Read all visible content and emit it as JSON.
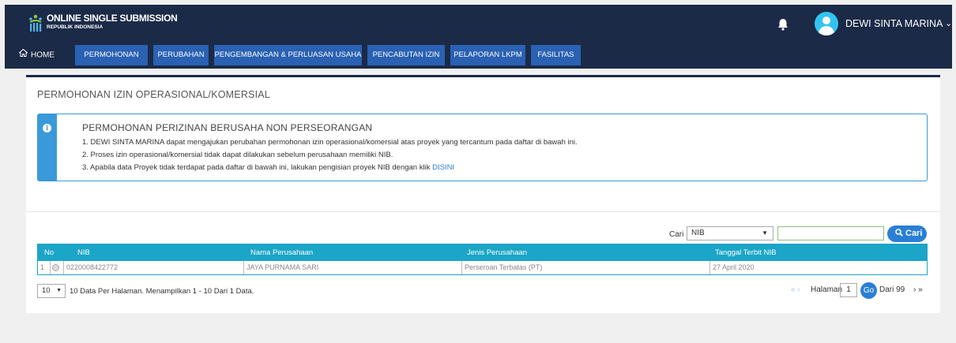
{
  "header": {
    "app_title": "ONLINE SINGLE SUBMISSION",
    "app_subtitle": "REPUBLIK INDONESIA",
    "username": "DEWI SINTA MARINA",
    "bell_icon": "bell-icon",
    "avatar_icon": "user-avatar-icon"
  },
  "nav": {
    "home": "HOME",
    "items": [
      "PERMOHONAN",
      "PERUBAHAN",
      "PENGEMBANGAN & PERLUASAN USAHA",
      "PENCABUTAN IZIN",
      "PELAPORAN LKPM",
      "FASILITAS"
    ]
  },
  "page": {
    "title": "PERMOHONAN IZIN OPERASIONAL/KOMERSIAL"
  },
  "info": {
    "title": "PERMOHONAN PERIZINAN BERUSAHA NON PERSEORANGAN",
    "line1": "1. DEWI SINTA MARINA dapat mengajukan perubahan permohonan izin operasional/komersial atas proyek yang tercantum pada daftar di bawah ini.",
    "line2": "2. Proses izin operasional/komersial tidak dapat dilakukan sebelum perusahaan memiliki NIB.",
    "line3": "3. Apabila data Proyek tidak terdapat pada daftar di bawah ini, lakukan pengisian proyek NIB dengan klik ",
    "link": "DISINI"
  },
  "search": {
    "label": "Cari",
    "field_selected": "NIB",
    "value": "",
    "button": "Cari"
  },
  "table": {
    "headers": [
      "No",
      "NIB",
      "Nama Perusahaan",
      "Jenis Perusahaan",
      "Tanggal Terbit NIB"
    ],
    "rows": [
      {
        "no": "1",
        "nib": "0220008422772",
        "nama": "JAYA PURNAMA SARI",
        "jenis": "Perseroan Terbatas (PT)",
        "tanggal": "27 April 2020"
      }
    ]
  },
  "footer": {
    "per_page": "10",
    "summary": "10 Data Per Halaman. Menampilkan 1 - 10 Dari 1 Data.",
    "prev": "« ‹",
    "page_label": "Halaman",
    "page": "1",
    "go": "Go",
    "total": "Dari 99",
    "next": "› »"
  },
  "colors": {
    "header_bg": "#1b2a47",
    "nav_item_bg": "#2a61b3",
    "table_head_bg": "#1ba5c7",
    "info_accent": "#3a9ad9",
    "button_blue": "#2a7fd4"
  }
}
